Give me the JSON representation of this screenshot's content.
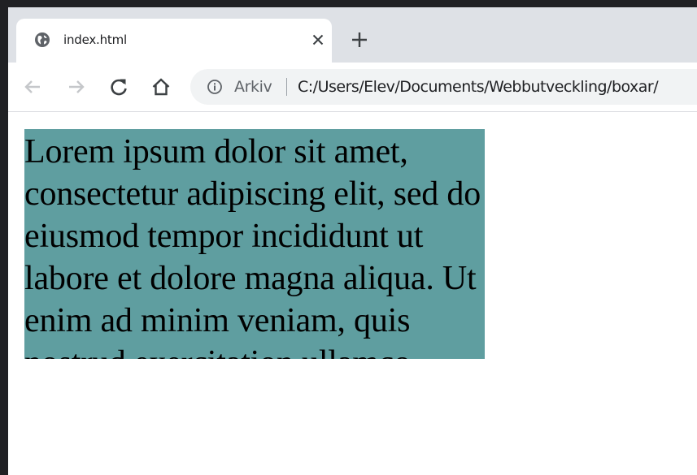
{
  "browser": {
    "tab": {
      "title": "index.html",
      "favicon": "globe-icon"
    },
    "toolbar": {
      "back_icon": "arrow-left-icon",
      "forward_icon": "arrow-right-icon",
      "reload_icon": "reload-icon",
      "home_icon": "home-icon"
    },
    "omnibox": {
      "info_icon": "info-icon",
      "scheme_label": "Arkiv",
      "url": "C:/Users/Elev/Documents/Webbutveckling/boxar/"
    },
    "colors": {
      "tabstrip": "#dee1e6",
      "omnibox": "#f1f3f4",
      "icon": "#5f6368"
    }
  },
  "page": {
    "box": {
      "text": "Lorem ipsum dolor sit amet, consectetur adipiscing elit, sed do eiusmod tempor incididunt ut labore et dolore magna aliqua. Ut enim ad minim veniam, quis nostrud exercitation ullamco laboris nisi ut aliquip ex ea commodo consequat.",
      "background": "#5f9ea0"
    }
  }
}
